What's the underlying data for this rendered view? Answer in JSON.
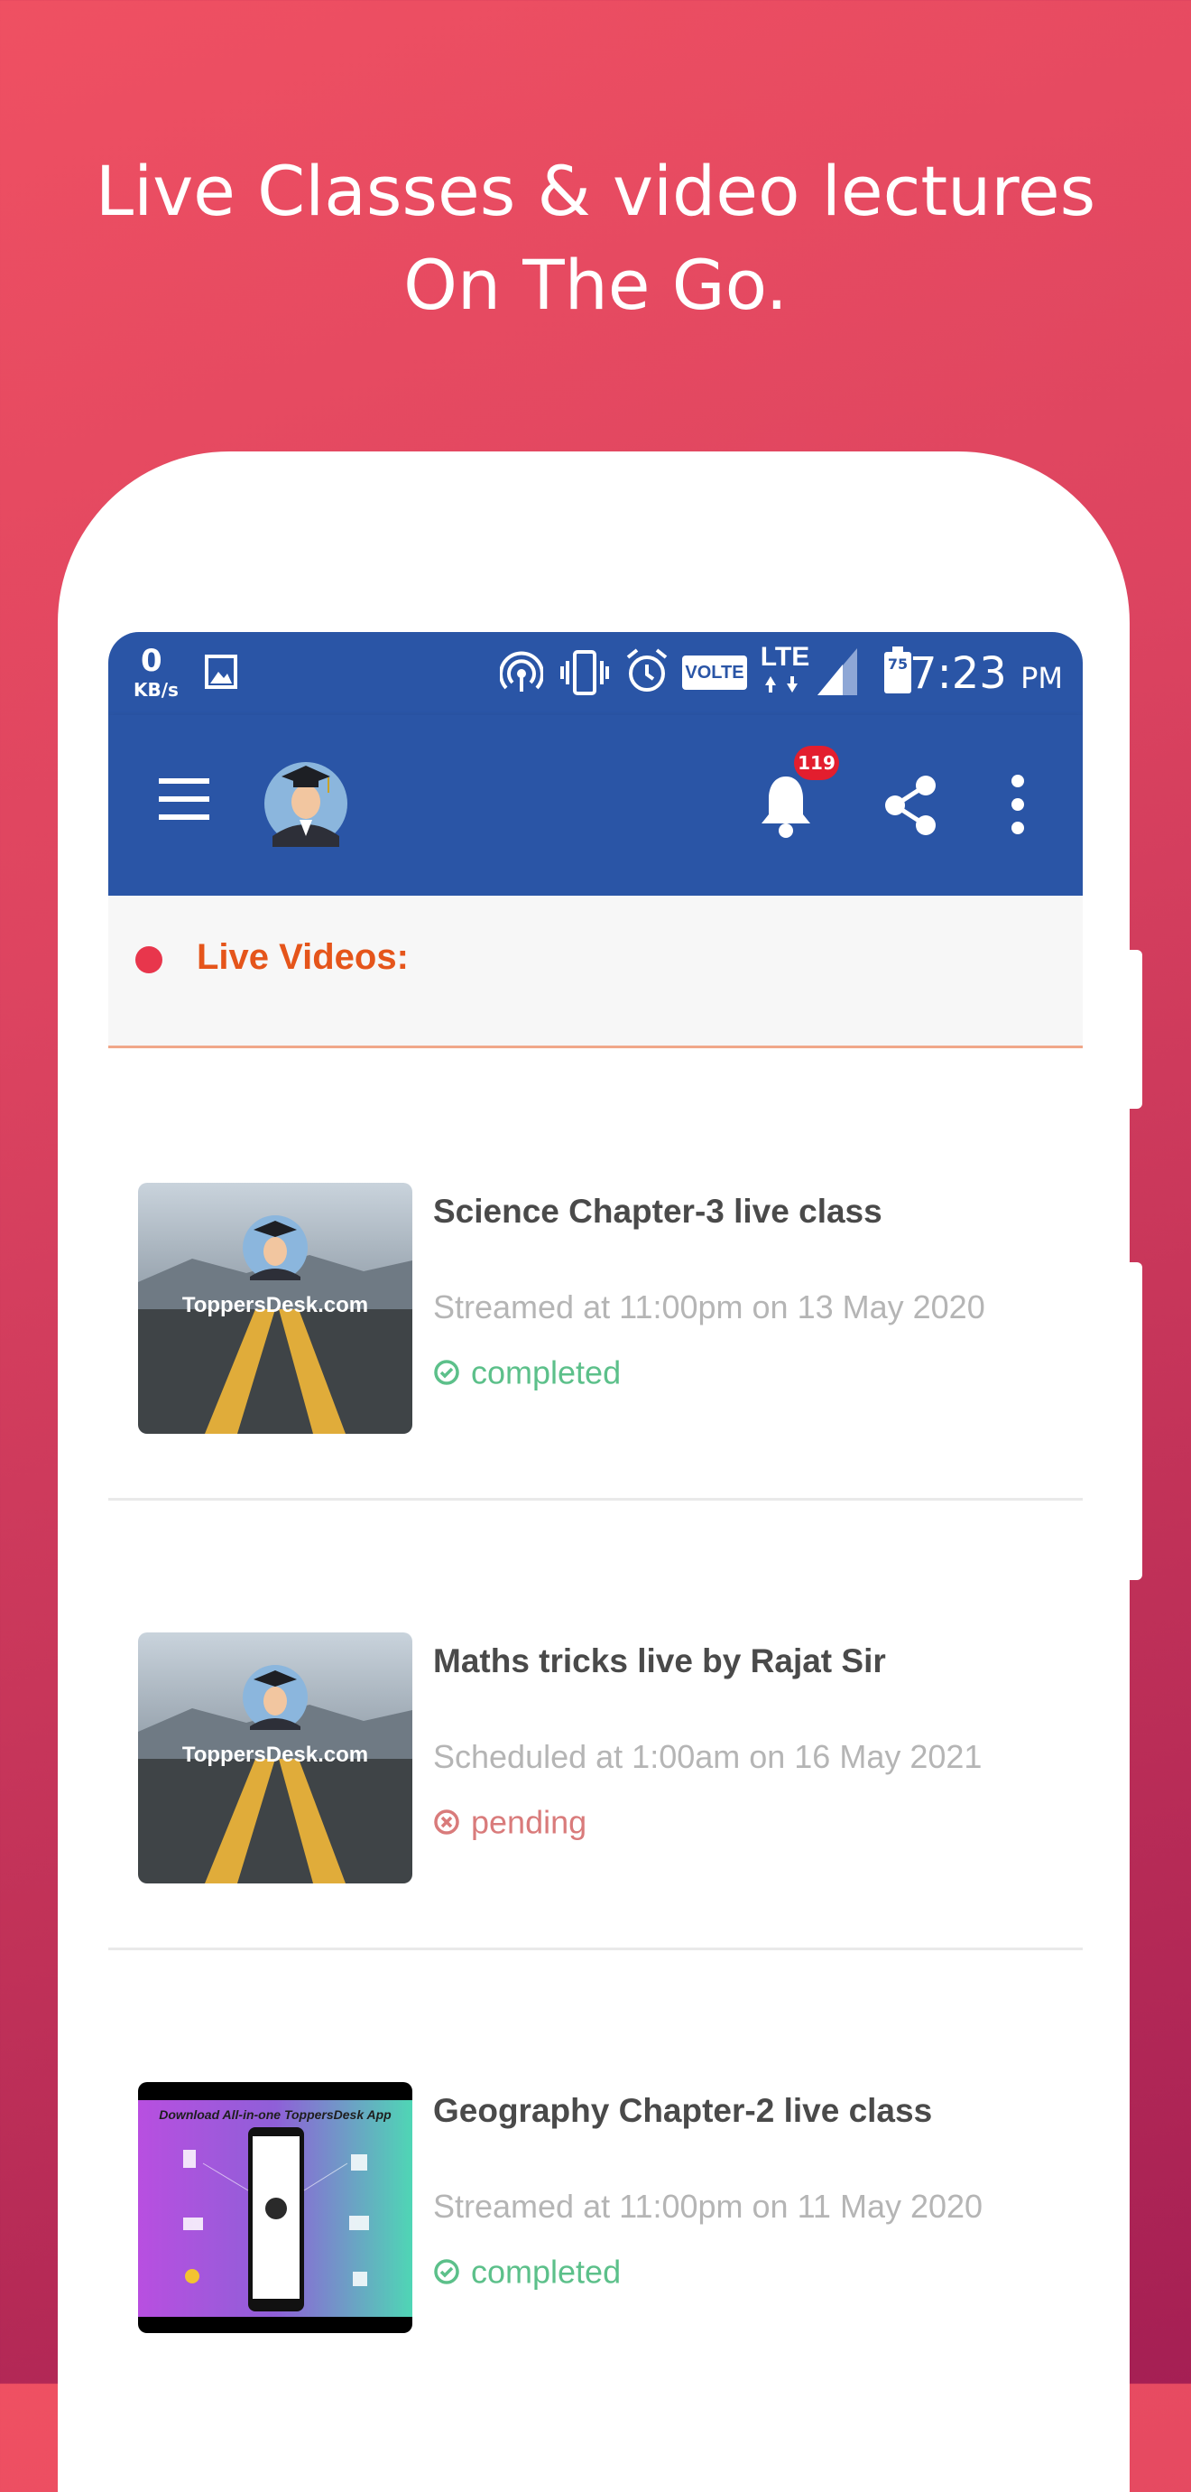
{
  "headline": {
    "line1": "Live Classes & video lectures",
    "line2": "On The Go."
  },
  "statusbar": {
    "speed_value": "0",
    "speed_unit": "KB/s",
    "network_label": "VOLTE",
    "lte_label": "LTE",
    "battery_level": "75",
    "time": "7:23",
    "ampm": "PM"
  },
  "appbar": {
    "notification_count": "119"
  },
  "section": {
    "title": "Live Videos:"
  },
  "thumb_brand": "ToppersDesk.com",
  "thumb_banner": "Download All-in-one ToppersDesk App",
  "videos": [
    {
      "title": "Science Chapter-3 live class",
      "time": "Streamed at 11:00pm on 13 May 2020",
      "status": "completed",
      "status_color": "#5cc08a",
      "thumb_style": "road"
    },
    {
      "title": "Maths tricks live by Rajat Sir",
      "time": "Scheduled at 1:00am on 16 May 2021",
      "status": "pending",
      "status_color": "#d97b7b",
      "thumb_style": "road"
    },
    {
      "title": "Geography Chapter-2 live class",
      "time": "Streamed at 11:00pm on 11 May 2020",
      "status": "completed",
      "status_color": "#5cc08a",
      "thumb_style": "promo"
    }
  ],
  "colors": {
    "appbar": "#2a55a6",
    "accent_orange": "#e5551b",
    "live_dot": "#e8364c",
    "badge": "#e31e2e"
  }
}
